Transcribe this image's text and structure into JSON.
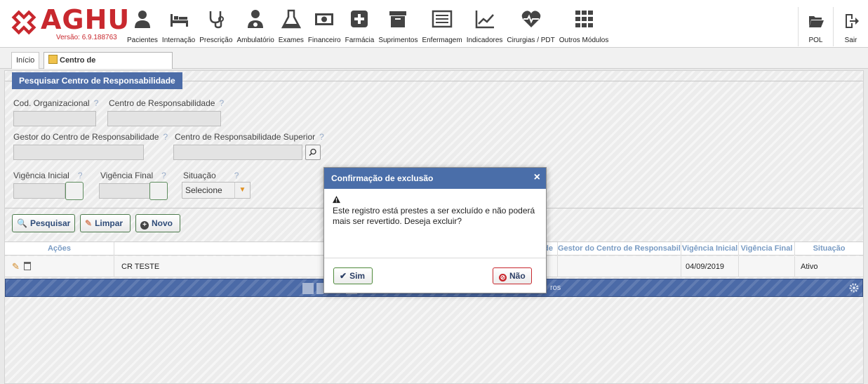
{
  "app": {
    "brand": "AGHU",
    "version": "Versão: 6.9.188763"
  },
  "modules": [
    {
      "name": "pacientes",
      "label": "Pacientes"
    },
    {
      "name": "internacao",
      "label": "Internação"
    },
    {
      "name": "prescricao",
      "label": "Prescrição"
    },
    {
      "name": "ambulatorio",
      "label": "Ambulatório"
    },
    {
      "name": "exames",
      "label": "Exames"
    },
    {
      "name": "financeiro",
      "label": "Financeiro"
    },
    {
      "name": "farmacia",
      "label": "Farmácia"
    },
    {
      "name": "suprimentos",
      "label": "Suprimentos"
    },
    {
      "name": "enfermagem",
      "label": "Enfermagem"
    },
    {
      "name": "indicadores",
      "label": "Indicadores"
    },
    {
      "name": "cirurgias",
      "label": "Cirurgias / PDT"
    },
    {
      "name": "outros",
      "label": "Outros Módulos"
    }
  ],
  "topright": {
    "pol": "POL",
    "sair": "Sair"
  },
  "tabs": {
    "inicio": "Início",
    "active": "Centro de Responsabilidade",
    "close": "×"
  },
  "search": {
    "legend": "Pesquisar Centro de Responsabilidade",
    "help": "?",
    "cod_label": "Cod. Organizacional",
    "centro_label": "Centro de Responsabilidade",
    "gestor_label": "Gestor do Centro de Responsabilidade",
    "superior_label": "Centro de Responsabilidade Superior",
    "vig_ini_label": "Vigência Inicial",
    "vig_fim_label": "Vigência Final",
    "situacao_label": "Situação",
    "situacao_value": "Selecione"
  },
  "buttons": {
    "pesquisar": "Pesquisar",
    "limpar": "Limpar",
    "novo": "Novo"
  },
  "table": {
    "headers": {
      "acoes": "Ações",
      "centro": "Centro de Responsabilidade",
      "gestor": "Gestor do Centro de Responsabilidade",
      "vig_ini": "Vigência Inicial",
      "vig_fim": "Vigência Final",
      "situacao": "Situação"
    },
    "rows": [
      {
        "centro": "CR TESTE",
        "gestor": "",
        "vig_ini": "04/09/2019",
        "vig_fim": "",
        "situacao": "Ativo"
      }
    ],
    "pager_text": "ros"
  },
  "modal": {
    "title": "Confirmação de exclusão",
    "close": "×",
    "message": "Este registro está prestes a ser excluído e não poderá mais ser revertido. Deseja excluir?",
    "sim": "Sim",
    "nao": "Não"
  },
  "colors": {
    "brand": "#c8282e",
    "header_blue": "#4a6ea9",
    "accept_green": "#4f8a3b"
  }
}
